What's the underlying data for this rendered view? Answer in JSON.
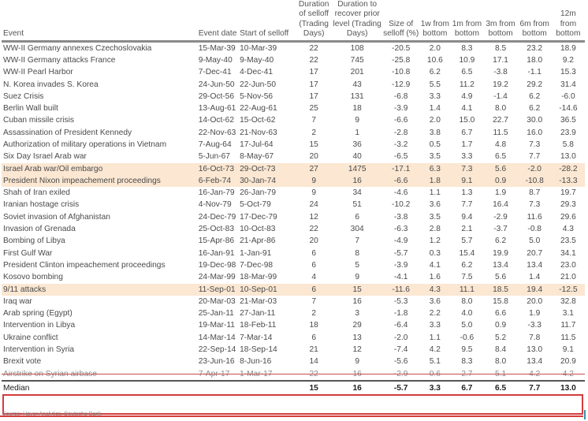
{
  "table": {
    "headers": [
      "Event",
      "Event date",
      "Start of selloff",
      "Duration of selloff (Trading Days)",
      "Duration to recover prior level (Trading Days)",
      "Size of selloff (%)",
      "1w from bottom",
      "1m from bottom",
      "3m from bottom",
      "6m from bottom",
      "12m from bottom"
    ],
    "rows": [
      {
        "event": "WW-II Germany annexes Czechoslovakia",
        "date": "15-Mar-39",
        "start": "10-Mar-39",
        "dur": "22",
        "rec": "108",
        "size": "-20.5",
        "w1": "2.0",
        "m1": "8.3",
        "m3": "8.5",
        "m6": "23.2",
        "m12": "18.9",
        "highlight": false
      },
      {
        "event": "WW-II Germany attacks France",
        "date": "9-May-40",
        "start": "9-May-40",
        "dur": "22",
        "rec": "745",
        "size": "-25.8",
        "w1": "10.6",
        "m1": "10.9",
        "m3": "17.1",
        "m6": "18.0",
        "m12": "9.2",
        "highlight": false
      },
      {
        "event": "WW-II Pearl Harbor",
        "date": "7-Dec-41",
        "start": "4-Dec-41",
        "dur": "17",
        "rec": "201",
        "size": "-10.8",
        "w1": "6.2",
        "m1": "6.5",
        "m3": "-3.8",
        "m6": "-1.1",
        "m12": "15.3",
        "highlight": false
      },
      {
        "event": "N. Korea invades S. Korea",
        "date": "24-Jun-50",
        "start": "22-Jun-50",
        "dur": "17",
        "rec": "43",
        "size": "-12.9",
        "w1": "5.5",
        "m1": "11.2",
        "m3": "19.2",
        "m6": "29.2",
        "m12": "31.4",
        "highlight": false
      },
      {
        "event": "Suez Crisis",
        "date": "29-Oct-56",
        "start": "5-Nov-56",
        "dur": "17",
        "rec": "131",
        "size": "-6.8",
        "w1": "3.3",
        "m1": "4.9",
        "m3": "-1.4",
        "m6": "6.2",
        "m12": "-6.0",
        "highlight": false
      },
      {
        "event": "Berlin Wall built",
        "date": "13-Aug-61",
        "start": "22-Aug-61",
        "dur": "25",
        "rec": "18",
        "size": "-3.9",
        "w1": "1.4",
        "m1": "4.1",
        "m3": "8.0",
        "m6": "6.2",
        "m12": "-14.6",
        "highlight": false
      },
      {
        "event": "Cuban missile crisis",
        "date": "14-Oct-62",
        "start": "15-Oct-62",
        "dur": "7",
        "rec": "9",
        "size": "-6.6",
        "w1": "2.0",
        "m1": "15.0",
        "m3": "22.7",
        "m6": "30.0",
        "m12": "36.5",
        "highlight": false
      },
      {
        "event": "Assassination of President Kennedy",
        "date": "22-Nov-63",
        "start": "21-Nov-63",
        "dur": "2",
        "rec": "1",
        "size": "-2.8",
        "w1": "3.8",
        "m1": "6.7",
        "m3": "11.5",
        "m6": "16.0",
        "m12": "23.9",
        "highlight": false
      },
      {
        "event": "Authorization of military operations in Vietnam",
        "date": "7-Aug-64",
        "start": "17-Jul-64",
        "dur": "15",
        "rec": "36",
        "size": "-3.2",
        "w1": "0.5",
        "m1": "1.7",
        "m3": "4.8",
        "m6": "7.3",
        "m12": "5.8",
        "highlight": false
      },
      {
        "event": "Six Day Israel Arab war",
        "date": "5-Jun-67",
        "start": "8-May-67",
        "dur": "20",
        "rec": "40",
        "size": "-6.5",
        "w1": "3.5",
        "m1": "3.3",
        "m3": "6.5",
        "m6": "7.7",
        "m12": "13.0",
        "highlight": false
      },
      {
        "event": "Israel Arab war/Oil embargo",
        "date": "16-Oct-73",
        "start": "29-Oct-73",
        "dur": "27",
        "rec": "1475",
        "size": "-17.1",
        "w1": "6.3",
        "m1": "7.3",
        "m3": "5.6",
        "m6": "-2.0",
        "m12": "-28.2",
        "highlight": true
      },
      {
        "event": "President Nixon impeachement proceedings",
        "date": "6-Feb-74",
        "start": "30-Jan-74",
        "dur": "9",
        "rec": "16",
        "size": "-6.6",
        "w1": "1.8",
        "m1": "9.1",
        "m3": "0.9",
        "m6": "-10.8",
        "m12": "-13.3",
        "highlight": true
      },
      {
        "event": "Shah of Iran exiled",
        "date": "16-Jan-79",
        "start": "26-Jan-79",
        "dur": "9",
        "rec": "34",
        "size": "-4.6",
        "w1": "1.1",
        "m1": "1.3",
        "m3": "1.9",
        "m6": "8.7",
        "m12": "19.7",
        "highlight": false
      },
      {
        "event": "Iranian hostage crisis",
        "date": "4-Nov-79",
        "start": "5-Oct-79",
        "dur": "24",
        "rec": "51",
        "size": "-10.2",
        "w1": "3.6",
        "m1": "7.7",
        "m3": "16.4",
        "m6": "7.3",
        "m12": "29.3",
        "highlight": false
      },
      {
        "event": "Soviet invasion of Afghanistan",
        "date": "24-Dec-79",
        "start": "17-Dec-79",
        "dur": "12",
        "rec": "6",
        "size": "-3.8",
        "w1": "3.5",
        "m1": "9.4",
        "m3": "-2.9",
        "m6": "11.6",
        "m12": "29.6",
        "highlight": false
      },
      {
        "event": "Invasion of Grenada",
        "date": "25-Oct-83",
        "start": "10-Oct-83",
        "dur": "22",
        "rec": "304",
        "size": "-6.3",
        "w1": "2.8",
        "m1": "2.1",
        "m3": "-3.7",
        "m6": "-0.8",
        "m12": "4.3",
        "highlight": false
      },
      {
        "event": "Bombing of Libya",
        "date": "15-Apr-86",
        "start": "21-Apr-86",
        "dur": "20",
        "rec": "7",
        "size": "-4.9",
        "w1": "1.2",
        "m1": "5.7",
        "m3": "6.2",
        "m6": "5.0",
        "m12": "23.5",
        "highlight": false
      },
      {
        "event": "First Gulf War",
        "date": "16-Jan-91",
        "start": "1-Jan-91",
        "dur": "6",
        "rec": "8",
        "size": "-5.7",
        "w1": "0.3",
        "m1": "15.4",
        "m3": "19.9",
        "m6": "20.7",
        "m12": "34.1",
        "highlight": false
      },
      {
        "event": "President Clinton impeachement proceedings",
        "date": "19-Dec-98",
        "start": "7-Dec-98",
        "dur": "6",
        "rec": "5",
        "size": "-3.9",
        "w1": "4.1",
        "m1": "6.2",
        "m3": "13.4",
        "m6": "13.4",
        "m12": "23.0",
        "highlight": false
      },
      {
        "event": "Kosovo bombing",
        "date": "24-Mar-99",
        "start": "18-Mar-99",
        "dur": "4",
        "rec": "9",
        "size": "-4.1",
        "w1": "1.6",
        "m1": "7.5",
        "m3": "5.6",
        "m6": "1.4",
        "m12": "21.0",
        "highlight": false
      },
      {
        "event": "9/11 attacks",
        "date": "11-Sep-01",
        "start": "10-Sep-01",
        "dur": "6",
        "rec": "15",
        "size": "-11.6",
        "w1": "4.3",
        "m1": "11.1",
        "m3": "18.5",
        "m6": "19.4",
        "m12": "-12.5",
        "highlight": true
      },
      {
        "event": "Iraq war",
        "date": "20-Mar-03",
        "start": "21-Mar-03",
        "dur": "7",
        "rec": "16",
        "size": "-5.3",
        "w1": "3.6",
        "m1": "8.0",
        "m3": "15.8",
        "m6": "20.0",
        "m12": "32.8",
        "highlight": false
      },
      {
        "event": "Arab spring (Egypt)",
        "date": "25-Jan-11",
        "start": "27-Jan-11",
        "dur": "2",
        "rec": "3",
        "size": "-1.8",
        "w1": "2.2",
        "m1": "4.0",
        "m3": "6.6",
        "m6": "1.9",
        "m12": "3.1",
        "highlight": false
      },
      {
        "event": "Intervention in Libya",
        "date": "19-Mar-11",
        "start": "18-Feb-11",
        "dur": "18",
        "rec": "29",
        "size": "-6.4",
        "w1": "3.3",
        "m1": "5.0",
        "m3": "0.9",
        "m6": "-3.3",
        "m12": "11.7",
        "highlight": false
      },
      {
        "event": "Ukraine conflict",
        "date": "14-Mar-14",
        "start": "7-Mar-14",
        "dur": "6",
        "rec": "13",
        "size": "-2.0",
        "w1": "1.1",
        "m1": "-0.6",
        "m3": "5.2",
        "m6": "7.8",
        "m12": "11.5",
        "highlight": false
      },
      {
        "event": "Intervention in Syria",
        "date": "22-Sep-14",
        "start": "18-Sep-14",
        "dur": "21",
        "rec": "12",
        "size": "-7.4",
        "w1": "4.2",
        "m1": "9.5",
        "m3": "8.4",
        "m6": "13.0",
        "m12": "9.1",
        "highlight": false
      },
      {
        "event": "Brexit vote",
        "date": "23-Jun-16",
        "start": "8-Jun-16",
        "dur": "14",
        "rec": "9",
        "size": "-5.6",
        "w1": "5.1",
        "m1": "8.3",
        "m3": "8.0",
        "m6": "13.4",
        "m12": "20.9",
        "highlight": false
      }
    ],
    "struck_row": {
      "event": "Airstrike on Syrian airbase",
      "date": "7-Apr-17",
      "start": "1-Mar-17",
      "dur": "22",
      "rec": "16",
      "size": "-2.9",
      "w1": "0.6",
      "m1": "2.7",
      "m3": "5.1",
      "m6": "4.2",
      "m12": "4.2"
    },
    "median": {
      "label": "Median",
      "dur": "15",
      "rec": "16",
      "size": "-5.7",
      "w1": "3.3",
      "m1": "6.7",
      "m3": "6.5",
      "m6": "7.7",
      "m12": "13.0"
    },
    "source": "Source: Haver Analytics, Deutsche Bank"
  },
  "colors": {
    "highlight": "#fbe7d2",
    "annotation_red": "#d33c3c"
  }
}
